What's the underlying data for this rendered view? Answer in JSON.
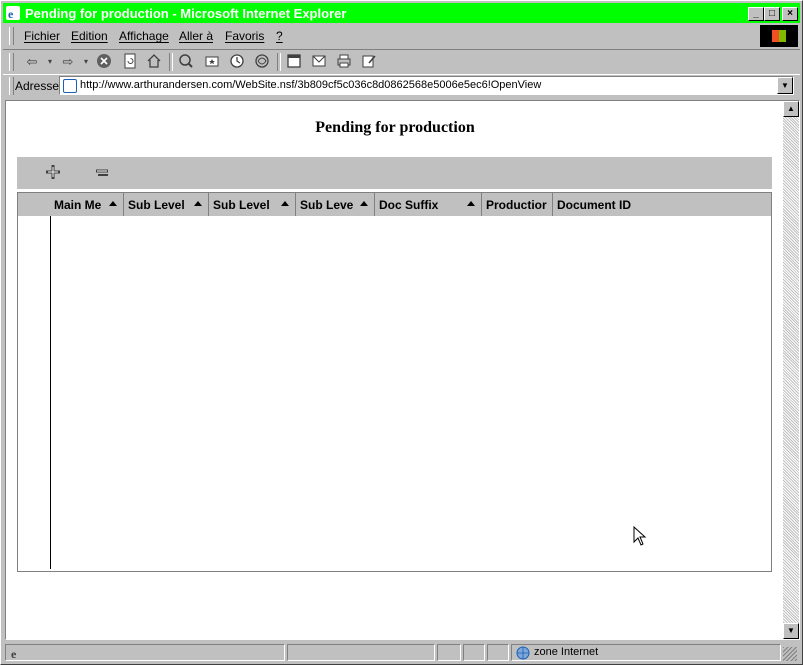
{
  "window": {
    "title": "Pending for production - Microsoft Internet Explorer",
    "buttons": {
      "minimize": "_",
      "maximize": "□",
      "close": "×"
    }
  },
  "menu": [
    "Fichier",
    "Edition",
    "Affichage",
    "Aller à",
    "Favoris",
    "?"
  ],
  "toolbar": {
    "icons": [
      "back-icon",
      "forward-icon",
      "stop-icon",
      "refresh-icon",
      "home-icon",
      "search-icon",
      "favorites-icon",
      "history-icon",
      "channels-icon",
      "fullscreen-icon",
      "mail-icon",
      "print-icon",
      "edit-icon"
    ]
  },
  "address": {
    "label": "Adresse",
    "url": "http://www.arthurandersen.com/WebSite.nsf/3b809cf5c036c8d0862568e5006e5ec6!OpenView"
  },
  "page": {
    "title": "Pending for production",
    "actions": [
      "expand-all-icon",
      "collapse-all-icon"
    ],
    "columns": [
      {
        "label": "Main Me",
        "sortable": true
      },
      {
        "label": "Sub Level",
        "sortable": true
      },
      {
        "label": "Sub Level",
        "sortable": true
      },
      {
        "label": "Sub Leve",
        "sortable": true
      },
      {
        "label": "Doc Suffix",
        "sortable": true
      },
      {
        "label": "Productior",
        "sortable": false
      },
      {
        "label": "Document ID",
        "sortable": false
      }
    ],
    "rows": []
  },
  "status": {
    "zone": "zone Internet"
  }
}
